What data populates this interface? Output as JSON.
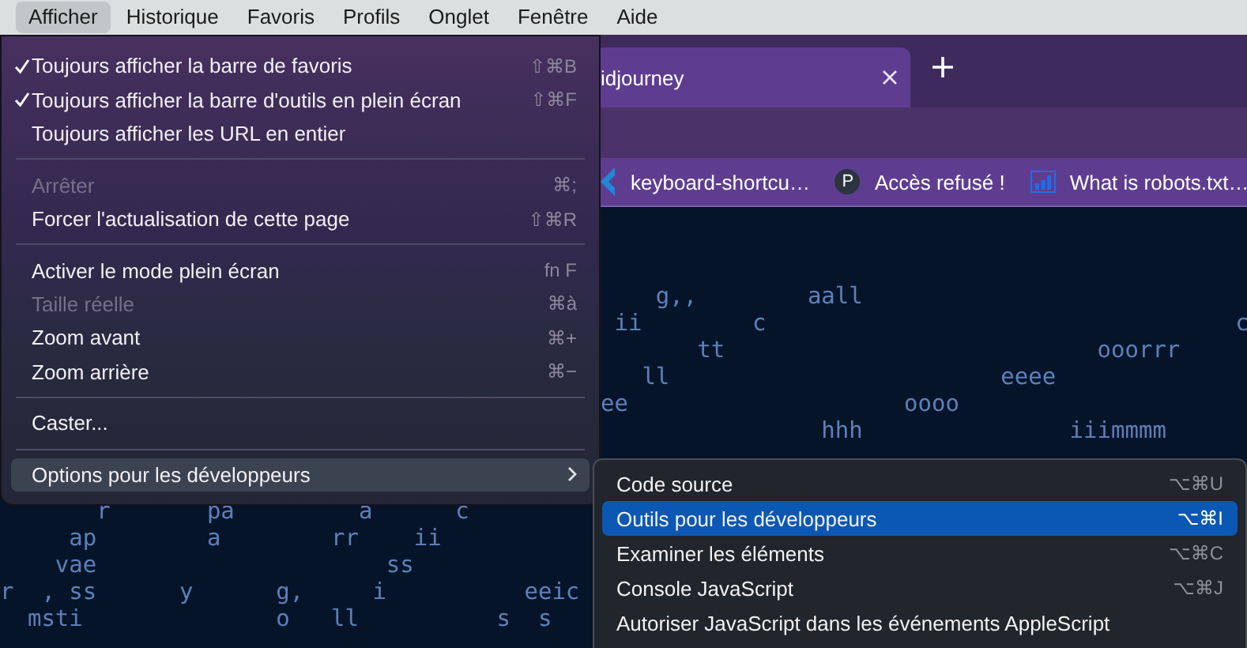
{
  "menu_bar": [
    {
      "label": "Afficher",
      "selected": true
    },
    {
      "label": "Historique",
      "selected": false
    },
    {
      "label": "Favoris",
      "selected": false
    },
    {
      "label": "Profils",
      "selected": false
    },
    {
      "label": "Onglet",
      "selected": false
    },
    {
      "label": "Fenêtre",
      "selected": false
    },
    {
      "label": "Aide",
      "selected": false
    }
  ],
  "browser": {
    "tab": {
      "title": "idjourney"
    },
    "bookmarks": [
      {
        "kind": "code",
        "label": "keyboard-shortcu…"
      },
      {
        "kind": "letter",
        "icon_letter": "P",
        "label": "Accès refusé !"
      },
      {
        "kind": "chart",
        "label": "What is robots.txt…"
      }
    ],
    "page_text_right": [
      "    g,,        aall",
      " ii        c                                  c",
      "       tt                           ooorrr",
      "   ll                        eeee",
      "ee                    oooo",
      "                hhh               iiimmmm"
    ],
    "page_text_left": [
      "       r       pa         a      c",
      "     ap        a        rr    ii",
      "    vae                     ss",
      "r  , ss      y      g,     i          eeic",
      "  msti              o   ll          s  s"
    ]
  },
  "menu": {
    "items": [
      {
        "kind": "item",
        "label": "Toujours afficher la barre de favoris",
        "checked": true,
        "disabled": false,
        "shortcut": "⇧⌘B",
        "selected": false
      },
      {
        "kind": "item",
        "label": "Toujours afficher la barre d'outils en plein écran",
        "checked": true,
        "disabled": false,
        "shortcut": "⇧⌘F",
        "selected": false
      },
      {
        "kind": "item",
        "label": "Toujours afficher les URL en entier",
        "checked": false,
        "disabled": false,
        "selected": false
      },
      {
        "kind": "separator"
      },
      {
        "kind": "item",
        "label": "Arrêter",
        "checked": false,
        "disabled": true,
        "shortcut": "⌘;",
        "selected": false
      },
      {
        "kind": "item",
        "label": "Forcer l'actualisation de cette page",
        "checked": false,
        "disabled": false,
        "shortcut": "⇧⌘R",
        "selected": false
      },
      {
        "kind": "separator"
      },
      {
        "kind": "item",
        "label": "Activer le mode plein écran",
        "checked": false,
        "disabled": false,
        "shortcut": "fn F",
        "selected": false
      },
      {
        "kind": "item",
        "label": "Taille réelle",
        "checked": false,
        "disabled": true,
        "shortcut": "⌘à",
        "selected": false
      },
      {
        "kind": "item",
        "label": "Zoom avant",
        "checked": false,
        "disabled": false,
        "shortcut": "⌘+",
        "selected": false
      },
      {
        "kind": "item",
        "label": "Zoom arrière",
        "checked": false,
        "disabled": false,
        "shortcut": "⌘−",
        "selected": false
      },
      {
        "kind": "separator"
      },
      {
        "kind": "item",
        "label": "Caster...",
        "checked": false,
        "disabled": false,
        "selected": false
      },
      {
        "kind": "separator"
      },
      {
        "kind": "submenu",
        "label": "Options pour les développeurs",
        "checked": false,
        "disabled": false,
        "selected": true
      }
    ]
  },
  "submenu": {
    "items": [
      {
        "label": "Code source",
        "shortcut": "⌥⌘U",
        "selected": false
      },
      {
        "label": "Outils pour les développeurs",
        "shortcut": "⌥⌘I",
        "selected": true
      },
      {
        "label": "Examiner les éléments",
        "shortcut": "⌥⌘C",
        "selected": false
      },
      {
        "label": "Console JavaScript",
        "shortcut": "⌥⌘J",
        "selected": false
      },
      {
        "label": "Autoriser JavaScript dans les événements AppleScript",
        "selected": false
      }
    ]
  }
}
